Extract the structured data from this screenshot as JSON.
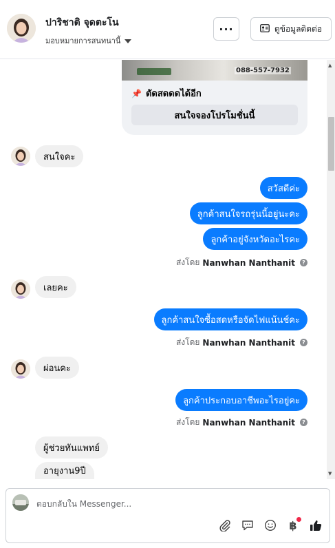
{
  "header": {
    "contact_name": "ปาริชาติ จุดตะโน",
    "assign_label": "มอบหมายการสนทนานี้",
    "more_label": "···",
    "contact_info_label": "ดูข้อมูลติดต่อ"
  },
  "card": {
    "image_phone": "088-557-7932",
    "title": "ตัดสดดดได้อีก",
    "button_label": "สนใจจองโปรโมชั่นนี้"
  },
  "messages": [
    {
      "dir": "in",
      "text": "สนใจคะ"
    },
    {
      "dir": "out",
      "text": "สวัสดีค่ะ"
    },
    {
      "dir": "out",
      "text": "ลูกค้าสนใจรถรุ่นนี้อยู่นะคะ"
    },
    {
      "dir": "out",
      "text": "ลูกค้าอยู่จังหวัดอะไรคะ"
    },
    {
      "dir": "in",
      "text": "เลยคะ"
    },
    {
      "dir": "out",
      "text": "ลูกค้าสนใจซื้อสดหรือจัดไฟแน้นช์คะ"
    },
    {
      "dir": "in",
      "text": "ผ่อนคะ"
    },
    {
      "dir": "out",
      "text": "ลูกค้าประกอบอาชีพอะไรอยู่คะ"
    },
    {
      "dir": "in",
      "text": "ผู้ช่วยทันแพทย์"
    },
    {
      "dir": "in",
      "text": "อายุงาน9ปี"
    }
  ],
  "sent_by": {
    "prefix": "ส่งโดย",
    "agent": "Nanwhan Nanthanit",
    "help": "?"
  },
  "composer": {
    "placeholder": "ตอบกลับใน Messenger...",
    "tools": [
      "paperclip-icon",
      "saved-reply-icon",
      "emoji-icon",
      "payment-icon",
      "thumbs-up-icon"
    ],
    "payment_symbol": "฿"
  },
  "colors": {
    "outgoing_bubble": "#0a7cff",
    "incoming_bubble": "#f0f0f0",
    "notification_dot": "#f02849"
  }
}
